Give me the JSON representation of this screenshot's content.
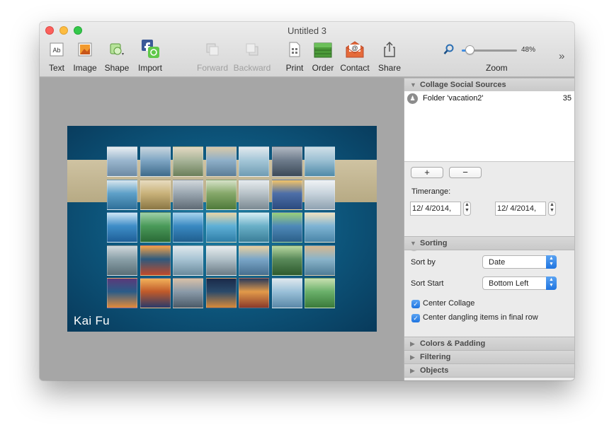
{
  "window": {
    "title": "Untitled 3"
  },
  "toolbar": {
    "text": "Text",
    "image": "Image",
    "shape": "Shape",
    "import": "Import",
    "forward": "Forward",
    "backward": "Backward",
    "print": "Print",
    "order": "Order",
    "contact": "Contact",
    "share": "Share",
    "zoom_label": "Zoom",
    "zoom_percent": "48%",
    "zoom_value": 0.48,
    "overflow": "»",
    "text_icon_glyph": "Ab"
  },
  "canvas": {
    "collage_name": "Kai Fu",
    "accent_color": "#0e5b82"
  },
  "sidebar": {
    "social_sources": {
      "title": "Collage Social Sources",
      "items": [
        {
          "name": "Folder 'vacation2'",
          "count": "35"
        }
      ],
      "add_label": "+",
      "remove_label": "−",
      "timerange_label": "Timerange:",
      "date_start": "12/  4/2014,",
      "date_end": "12/  4/2014,",
      "range_start": 0.0,
      "range_end": 1.0
    },
    "sorting": {
      "title": "Sorting",
      "sort_by_label": "Sort by",
      "sort_by_value": "Date",
      "sort_start_label": "Sort Start",
      "sort_start_value": "Bottom Left",
      "center_collage": "Center Collage",
      "center_dangling": "Center dangling items in final row"
    },
    "colors_padding": {
      "title": "Colors & Padding"
    },
    "filtering": {
      "title": "Filtering"
    },
    "objects": {
      "title": "Objects"
    }
  }
}
